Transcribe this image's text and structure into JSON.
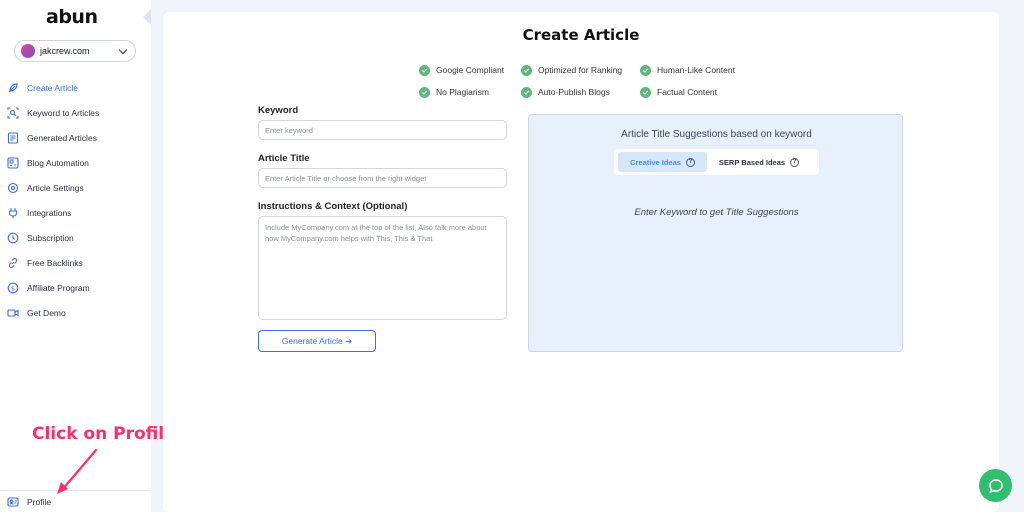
{
  "app": {
    "logo": "abun"
  },
  "sidebar": {
    "site_selector": {
      "value": "jakcrew.com"
    },
    "items": [
      {
        "label": "Create Article",
        "icon": "feather-icon",
        "active": true
      },
      {
        "label": "Keyword to Articles",
        "icon": "keyword-scan-icon"
      },
      {
        "label": "Generated Articles",
        "icon": "articles-icon"
      },
      {
        "label": "Blog Automation",
        "icon": "automation-icon"
      },
      {
        "label": "Article Settings",
        "icon": "settings-icon"
      },
      {
        "label": "Integrations",
        "icon": "plug-icon"
      },
      {
        "label": "Subscription",
        "icon": "subscription-icon"
      },
      {
        "label": "Free Backlinks",
        "icon": "link-icon"
      },
      {
        "label": "Affiliate Program",
        "icon": "dollar-icon"
      },
      {
        "label": "Get Demo",
        "icon": "video-icon"
      }
    ],
    "profile_label": "Profile"
  },
  "annotation": {
    "text": "Click on Profile",
    "color": "#ff2d6b"
  },
  "main": {
    "title": "Create Article",
    "features": [
      "Google Compliant",
      "Optimized for Ranking",
      "Human-Like Content",
      "No Plagiarism",
      "Auto-Publish Blogs",
      "Factual Content"
    ],
    "keyword": {
      "label": "Keyword",
      "placeholder": "Enter keyword"
    },
    "article_title": {
      "label": "Article Title",
      "placeholder": "Enter Article Title or choose from the right widget"
    },
    "instructions": {
      "label": "Instructions & Context (Optional)",
      "placeholder": "Include MyCompany.com at the top of the list, Also talk more about how MyCompany.com helps with This, This & That"
    },
    "generate_button": "Generate Article ➔",
    "suggestions": {
      "title": "Article Title Suggestions based on keyword",
      "tabs": [
        {
          "label": "Creative Ideas",
          "active": true
        },
        {
          "label": "SERP Based Ideas",
          "active": false
        }
      ],
      "help_glyph": "?",
      "empty_message": "Enter Keyword to get Title Suggestions"
    }
  },
  "colors": {
    "accent": "#3b6fe0",
    "check": "#5fb87b",
    "chat": "#2fbf71",
    "panel": "#e8f0fb"
  }
}
